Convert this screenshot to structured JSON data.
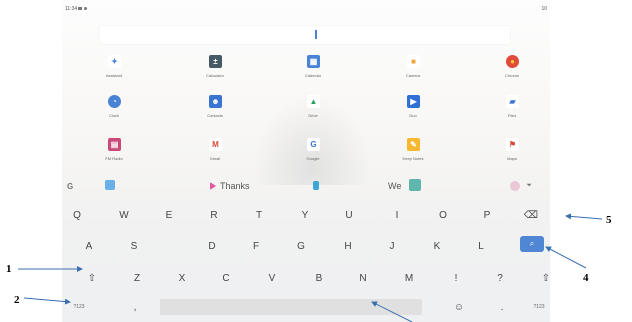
{
  "status": {
    "time": "11:34",
    "right": "10"
  },
  "apps": [
    {
      "label": "Assistant",
      "icon": "assistant-icon",
      "color": "#ffffff",
      "glyph": "✦",
      "fg": "#4a83d6",
      "round": false
    },
    {
      "label": "Calculator",
      "icon": "calculator-icon",
      "color": "#455a64",
      "glyph": "±",
      "fg": "#ffffff",
      "round": false
    },
    {
      "label": "Calendar",
      "icon": "calendar-icon",
      "color": "#4a83d6",
      "glyph": "▦",
      "fg": "#ffffff",
      "round": false
    },
    {
      "label": "Camera",
      "icon": "camera-icon",
      "color": "#ffffff",
      "glyph": "■",
      "fg": "#f2a33a",
      "round": false
    },
    {
      "label": "Chrome",
      "icon": "chrome-icon",
      "color": "#e04b3a",
      "glyph": "●",
      "fg": "#f8c630",
      "round": true
    },
    {
      "label": "Clock",
      "icon": "clock-icon",
      "color": "#4a83d6",
      "glyph": "◔",
      "fg": "#ffffff",
      "round": true
    },
    {
      "label": "Contacts",
      "icon": "contacts-icon",
      "color": "#3a74d1",
      "glyph": "☻",
      "fg": "#ffffff",
      "round": false
    },
    {
      "label": "Drive",
      "icon": "drive-icon",
      "color": "#ffffff",
      "glyph": "▲",
      "fg": "#2aa05a",
      "round": false
    },
    {
      "label": "Duo",
      "icon": "duo-icon",
      "color": "#2f6fd6",
      "glyph": "▶",
      "fg": "#ffffff",
      "round": false
    },
    {
      "label": "Files",
      "icon": "files-icon",
      "color": "#ffffff",
      "glyph": "▰",
      "fg": "#3a74d1",
      "round": false
    },
    {
      "label": "FM Radio",
      "icon": "radio-icon",
      "color": "#c94a7a",
      "glyph": "▤",
      "fg": "#ffffff",
      "round": false
    },
    {
      "label": "Gmail",
      "icon": "gmail-icon",
      "color": "#ffffff",
      "glyph": "M",
      "fg": "#d94a3a",
      "round": false
    },
    {
      "label": "Google",
      "icon": "google-icon",
      "color": "#ffffff",
      "glyph": "G",
      "fg": "#3a74d1",
      "round": false
    },
    {
      "label": "Keep Notes",
      "icon": "keep-icon",
      "color": "#f5b82e",
      "glyph": "✎",
      "fg": "#ffffff",
      "round": false
    },
    {
      "label": "Maps",
      "icon": "maps-icon",
      "color": "#ffffff",
      "glyph": "⚑",
      "fg": "#d94a3a",
      "round": false
    }
  ],
  "suggestions": {
    "word1": "Thanks",
    "word2": "We"
  },
  "keyboard": {
    "row1": [
      "Q",
      "W",
      "E",
      "R",
      "T",
      "Y",
      "U",
      "I",
      "O",
      "P",
      "⌫"
    ],
    "row2": [
      "A",
      "S",
      "D",
      "F",
      "G",
      "H",
      "J",
      "K",
      "L"
    ],
    "row2_action": "⌕",
    "row3": [
      "⇧",
      "Z",
      "X",
      "C",
      "V",
      "B",
      "N",
      "M",
      "!",
      "?",
      "⇧"
    ],
    "row4_left": "?123",
    "row4_comma": ",",
    "row4_emoji": "☺",
    "row4_period": ".",
    "row4_right": "?123"
  },
  "callouts": {
    "c1": "1",
    "c2": "2",
    "c4": "4",
    "c5": "5"
  },
  "colors": {
    "accent": "#4f87d4"
  }
}
